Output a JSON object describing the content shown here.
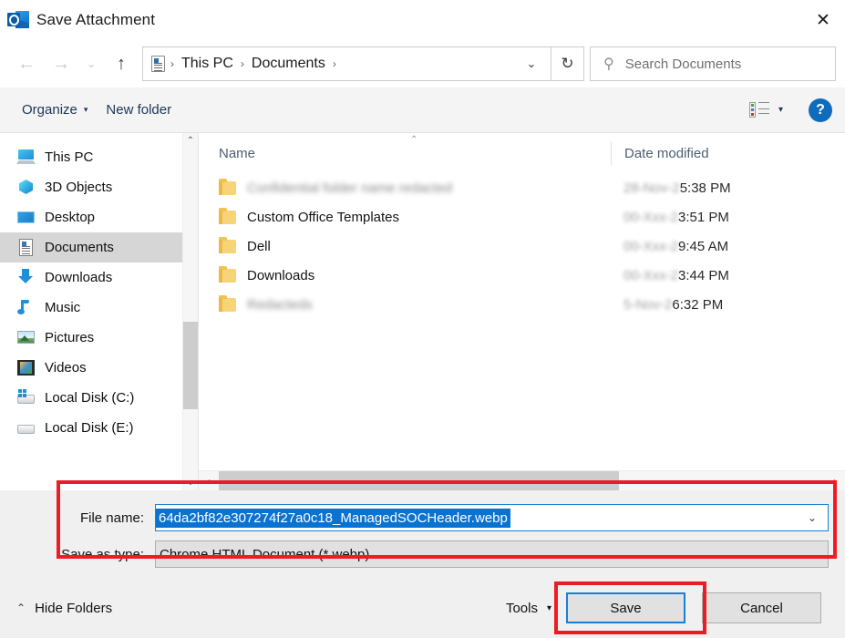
{
  "window": {
    "title": "Save Attachment",
    "app_icon": "outlook-icon",
    "close_label": "✕"
  },
  "address_bar": {
    "back_label": "←",
    "forward_label": "→",
    "recent_label": "⌄",
    "up_label": "↑",
    "path_icon": "documents-folder-icon",
    "breadcrumbs": [
      "This PC",
      "Documents"
    ],
    "separator": "›",
    "dropdown_label": "⌄",
    "refresh_label": "↻",
    "search_placeholder": "Search Documents",
    "search_value": "",
    "search_icon": "search-icon"
  },
  "toolbar": {
    "organize_label": "Organize",
    "organize_caret": "▾",
    "new_folder_label": "New folder",
    "view_icon": "list-view-icon",
    "view_caret": "▾",
    "help_label": "?"
  },
  "sidebar": {
    "items": [
      {
        "label": "This PC",
        "icon": "computer-icon",
        "selected": false
      },
      {
        "label": "3D Objects",
        "icon": "3d-objects-icon",
        "selected": false
      },
      {
        "label": "Desktop",
        "icon": "desktop-icon",
        "selected": false
      },
      {
        "label": "Documents",
        "icon": "documents-icon",
        "selected": true
      },
      {
        "label": "Downloads",
        "icon": "downloads-icon",
        "selected": false
      },
      {
        "label": "Music",
        "icon": "music-icon",
        "selected": false
      },
      {
        "label": "Pictures",
        "icon": "pictures-icon",
        "selected": false
      },
      {
        "label": "Videos",
        "icon": "videos-icon",
        "selected": false
      },
      {
        "label": "Local Disk (C:)",
        "icon": "windows-disk-icon",
        "selected": false
      },
      {
        "label": "Local Disk (E:)",
        "icon": "disk-icon",
        "selected": false
      }
    ],
    "scroll_up": "⌃",
    "scroll_down": "⌄"
  },
  "file_list": {
    "columns": [
      "Name",
      "Date modified"
    ],
    "sort_indicator": "⌃",
    "rows": [
      {
        "name": "Confidential folder name redacted",
        "name_blurred": true,
        "date": "28-Nov-23 5:38 PM",
        "date_blurred_prefix": true,
        "date_visible": "5:38 PM"
      },
      {
        "name": "Custom Office Templates",
        "name_blurred": false,
        "date": "3:51 PM",
        "date_blurred_prefix": true,
        "date_visible": "3:51 PM"
      },
      {
        "name": "Dell",
        "name_blurred": false,
        "date": "9:45 AM",
        "date_blurred_prefix": true,
        "date_visible": "9:45 AM"
      },
      {
        "name": "Downloads",
        "name_blurred": false,
        "date": "3:44 PM",
        "date_blurred_prefix": true,
        "date_visible": "3:44 PM"
      },
      {
        "name": "Redacteds",
        "name_blurred": true,
        "date": "5-Nov-23 6:32 PM",
        "date_blurred_prefix": true,
        "date_visible": "6:32 PM"
      }
    ],
    "hscroll_left": "‹",
    "hscroll_right": "›"
  },
  "save_panel": {
    "file_name_label": "File name:",
    "file_name_value": "64da2bf82e307274f27a0c18_ManagedSOCHeader.webp",
    "file_name_selected": true,
    "save_as_type_label": "Save as type:",
    "save_as_type_value": "Chrome HTML Document (*.webp)",
    "combo_caret": "⌄"
  },
  "footer": {
    "hide_folders_label": "Hide Folders",
    "hide_folders_caret": "⌃",
    "tools_label": "Tools",
    "tools_caret": "▾",
    "save_label": "Save",
    "cancel_label": "Cancel"
  },
  "annotations": {
    "highlight_color": "#ec1c24",
    "focus_color": "#1a7fd4",
    "selection_color": "#0a72d0"
  }
}
